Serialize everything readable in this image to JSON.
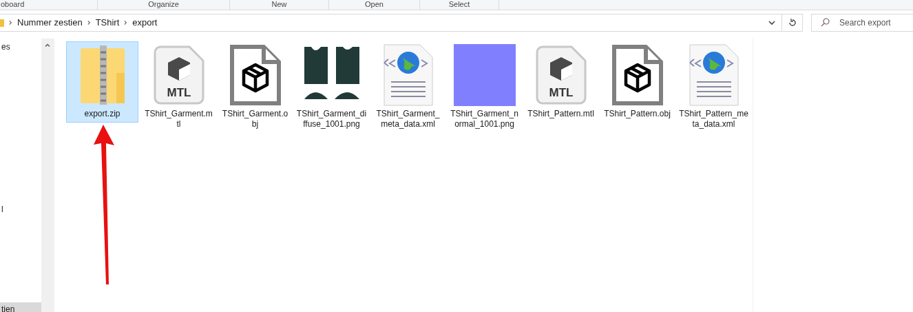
{
  "ribbon_groups": [
    "oboard",
    "Organize",
    "New",
    "Open",
    "Select"
  ],
  "address_bar": {
    "crumbs": [
      "Nummer zestien",
      "TShirt",
      "export"
    ]
  },
  "search": {
    "placeholder": "Search export"
  },
  "sidebar": {
    "items": [
      {
        "label": "es",
        "selected": false
      },
      {
        "label": "l",
        "selected": false
      },
      {
        "label": "tien",
        "selected": true
      }
    ]
  },
  "files": [
    {
      "name": "export.zip",
      "kind": "zip",
      "selected": true
    },
    {
      "name": "TShirt_Garment.mtl",
      "kind": "mtl",
      "icon_text": "MTL",
      "selected": false
    },
    {
      "name": "TShirt_Garment.obj",
      "kind": "obj",
      "selected": false
    },
    {
      "name": "TShirt_Garment_diffuse_1001.png",
      "kind": "diffuse",
      "selected": false
    },
    {
      "name": "TShirt_Garment_meta_data.xml",
      "kind": "xml",
      "selected": false
    },
    {
      "name": "TShirt_Garment_normal_1001.png",
      "kind": "normal",
      "selected": false
    },
    {
      "name": "TShirt_Pattern.mtl",
      "kind": "mtl",
      "icon_text": "MTL",
      "selected": false
    },
    {
      "name": "TShirt_Pattern.obj",
      "kind": "obj",
      "selected": false
    },
    {
      "name": "TShirt_Pattern_meta_data.xml",
      "kind": "xml",
      "selected": false
    }
  ]
}
